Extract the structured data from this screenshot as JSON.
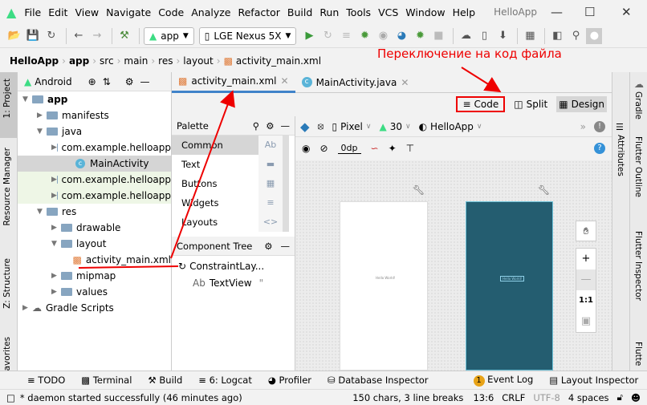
{
  "menu": {
    "items": [
      "File",
      "Edit",
      "View",
      "Navigate",
      "Code",
      "Analyze",
      "Refactor",
      "Build",
      "Run",
      "Tools",
      "VCS",
      "Window",
      "Help"
    ],
    "title": "HelloApp"
  },
  "toolbar": {
    "config": "app",
    "device": "LGE Nexus 5X"
  },
  "breadcrumb": [
    "HelloApp",
    "app",
    "src",
    "main",
    "res",
    "layout",
    "activity_main.xml"
  ],
  "left_strip": [
    "1: Project",
    "Resource Manager",
    "Z: Structure",
    "avorites"
  ],
  "project": {
    "view": "Android",
    "tree": [
      {
        "label": "app",
        "level": 0,
        "type": "folder",
        "bold": true
      },
      {
        "label": "manifests",
        "level": 1,
        "type": "folder"
      },
      {
        "label": "java",
        "level": 1,
        "type": "folder"
      },
      {
        "label": "com.example.helloapp",
        "level": 2,
        "type": "package"
      },
      {
        "label": "MainActivity",
        "level": 3,
        "type": "class",
        "selected": true
      },
      {
        "label": "com.example.helloapp",
        "level": 2,
        "type": "package",
        "tint": true
      },
      {
        "label": "com.example.helloapp",
        "level": 2,
        "type": "package",
        "tint": true
      },
      {
        "label": "res",
        "level": 1,
        "type": "folder"
      },
      {
        "label": "drawable",
        "level": 2,
        "type": "folder"
      },
      {
        "label": "layout",
        "level": 2,
        "type": "folder"
      },
      {
        "label": "activity_main.xml",
        "level": 3,
        "type": "xml"
      },
      {
        "label": "mipmap",
        "level": 2,
        "type": "folder"
      },
      {
        "label": "values",
        "level": 2,
        "type": "folder"
      },
      {
        "label": "Gradle Scripts",
        "level": 0,
        "type": "gradle"
      }
    ]
  },
  "editor": {
    "tabs": [
      "activity_main.xml",
      "MainActivity.java"
    ],
    "modes": [
      "Code",
      "Split",
      "Design"
    ],
    "active_mode": "Design"
  },
  "palette": {
    "title": "Palette",
    "categories": [
      "Common",
      "Text",
      "Buttons",
      "Widgets",
      "Layouts"
    ],
    "selected": "Common",
    "ab": "Ab"
  },
  "component_tree": {
    "title": "Component Tree",
    "items": [
      "ConstraintLay...",
      "TextView"
    ],
    "textview_suffix": "\""
  },
  "design_toolbar": {
    "device": "Pixel",
    "api": "30",
    "theme": "HelloApp",
    "margin": "0dp"
  },
  "canvas": {
    "hello": "Hello World!",
    "zoom_fit": "1:1",
    "blueprint_color": "#245d70"
  },
  "right_strip": [
    "Attributes",
    "Gradle",
    "Flutter Outline",
    "Flutter Inspector",
    "Flutte"
  ],
  "bottom_tools": [
    "TODO",
    "Terminal",
    "Build",
    "6: Logcat",
    "Profiler",
    "Database Inspector",
    "Event Log",
    "Layout Inspector"
  ],
  "event_count": "1",
  "status": {
    "message": "* daemon started successfully (46 minutes ago)",
    "chars": "150 chars, 3 line breaks",
    "position": "13:6",
    "line_sep": "CRLF",
    "encoding": "UTF-8",
    "indent": "4 spaces"
  },
  "annotation": {
    "text": "Переключение на код файла",
    "color": "#ff0000"
  }
}
